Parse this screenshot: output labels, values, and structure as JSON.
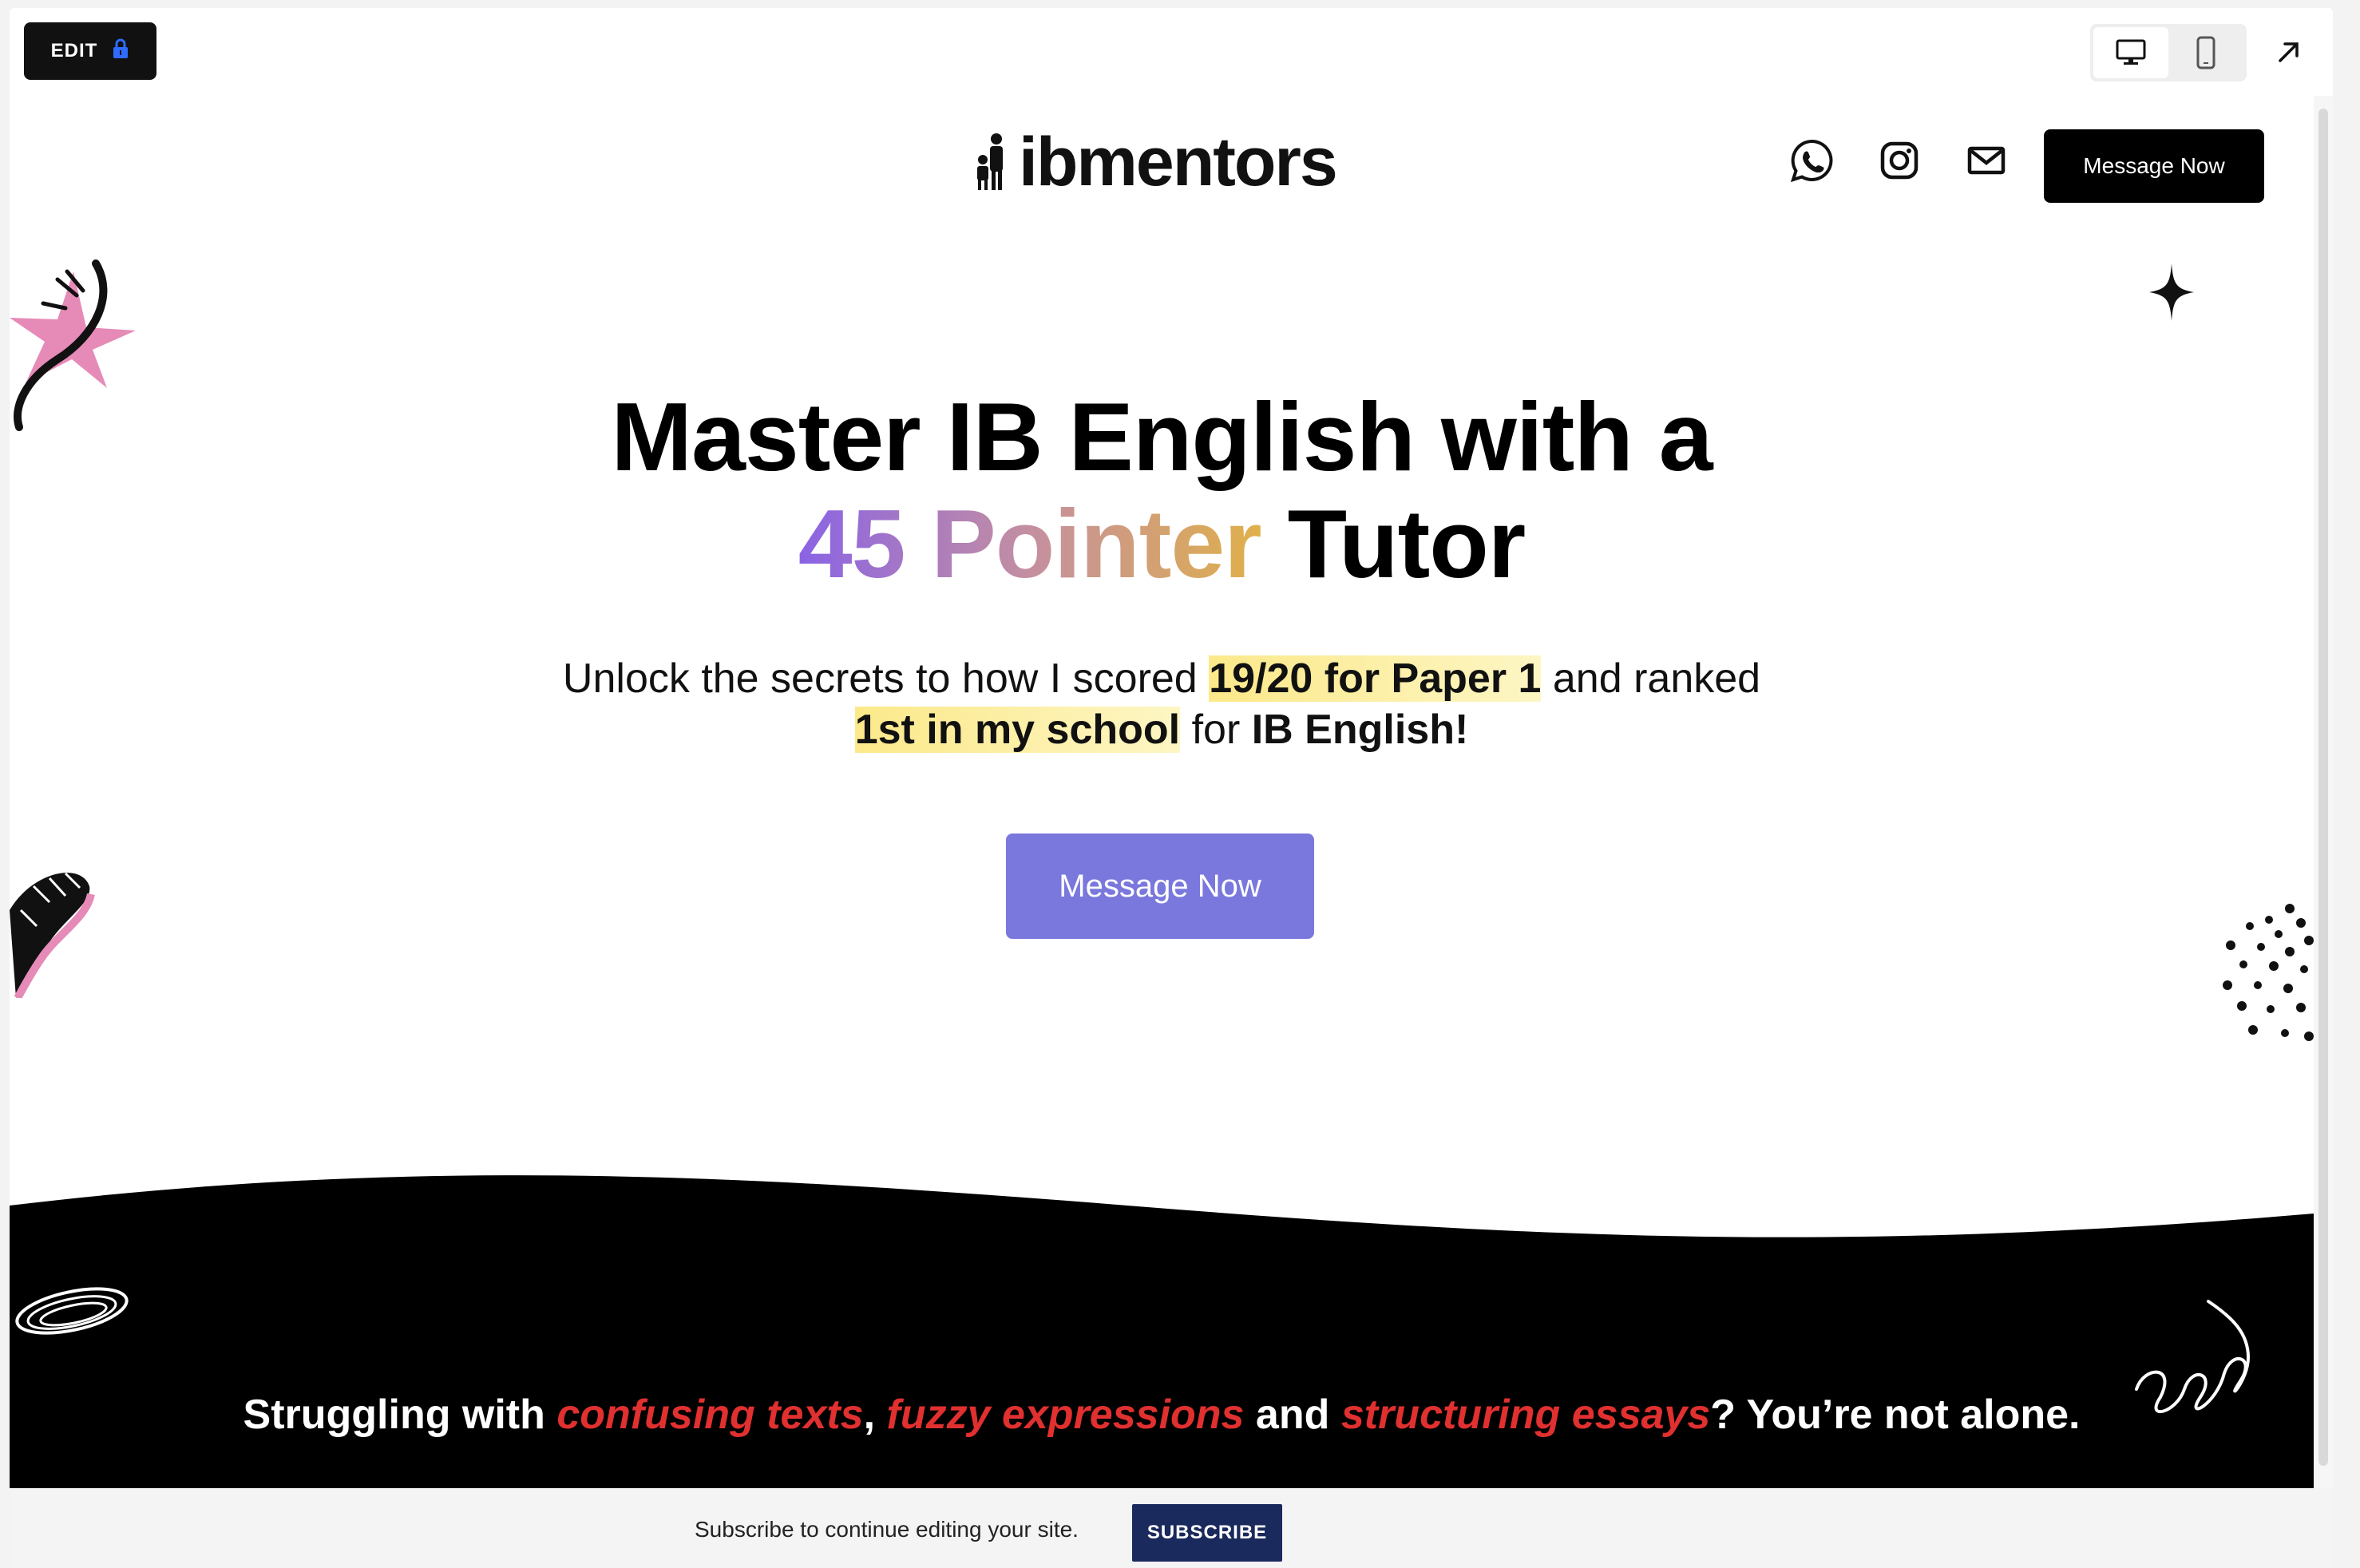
{
  "editor": {
    "edit_label": "EDIT",
    "lock_icon": "lock-icon",
    "desktop_icon": "desktop-icon",
    "mobile_icon": "mobile-icon",
    "expand_icon": "arrow-up-right-icon"
  },
  "site": {
    "logo_text": "ibmentors",
    "logo_icon": "mentor-figures-icon",
    "social_icons": [
      "whatsapp-icon",
      "instagram-icon",
      "mail-icon"
    ],
    "nav_cta": "Message Now",
    "hero": {
      "title_line1": "Master IB English with a",
      "title_grad": "45 Pointer",
      "title_rest": "Tutor",
      "sub_pre": "Unlock the secrets to how I scored",
      "sub_hl1": "19/20 for Paper 1",
      "sub_mid": "and ranked",
      "sub_hl2": "1st in my school",
      "sub_for": "for",
      "sub_bold": "IB English!",
      "cta": "Message Now"
    },
    "tagline": {
      "pre": "Struggling with",
      "r1": "confusing texts",
      "c1": ",",
      "r2": "fuzzy expressions",
      "and": "and",
      "r3": "structuring essays",
      "post": "? You’re not alone."
    }
  },
  "subscribe": {
    "text": "Subscribe to continue editing your site.",
    "button": "SUBSCRIBE"
  },
  "colors": {
    "accent_button": "#7a78dc",
    "highlight": "#fce98a",
    "tagline_red": "#e0302f",
    "subscribe_button": "#1b2a5c",
    "pink_decor": "#e68ab7"
  }
}
